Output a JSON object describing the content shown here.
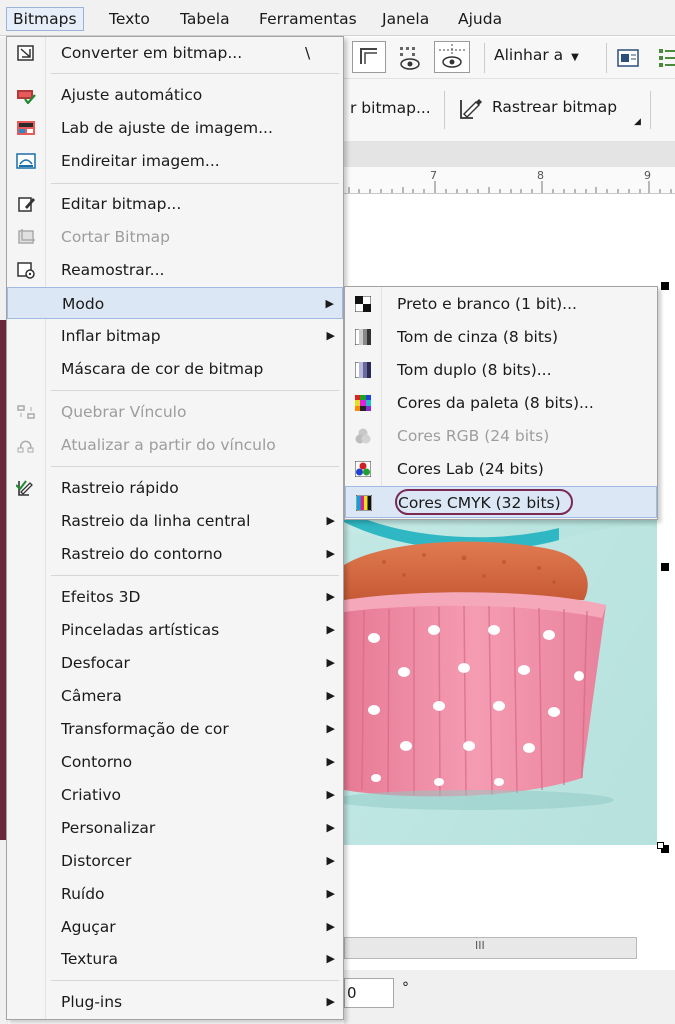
{
  "menubar": {
    "items": [
      "Bitmaps",
      "Texto",
      "Tabela",
      "Ferramentas",
      "Janela",
      "Ajuda"
    ]
  },
  "toolbar": {
    "align_label": "Alinhar a",
    "convert_partial": "r bitmap...",
    "trace_label": "Rastrear bitmap"
  },
  "ruler": {
    "ticks": [
      "7",
      "8",
      "9"
    ]
  },
  "bottom": {
    "field_value": "0",
    "degree": "°",
    "scroll_grip": "III"
  },
  "menu": {
    "items": [
      {
        "label": "Converter em bitmap...",
        "shortcut": "\\",
        "icon": "convert-bitmap-icon"
      },
      {
        "label": "Ajuste automático",
        "icon": "auto-adjust-icon"
      },
      {
        "label": "Lab de ajuste de imagem...",
        "icon": "image-adjust-lab-icon"
      },
      {
        "label": "Endireitar imagem...",
        "icon": "straighten-image-icon"
      },
      {
        "label": "Editar bitmap...",
        "icon": "edit-bitmap-icon"
      },
      {
        "label": "Cortar Bitmap",
        "icon": "crop-bitmap-icon"
      },
      {
        "label": "Reamostrar...",
        "icon": "resample-icon"
      },
      {
        "label": "Modo"
      },
      {
        "label": "Inflar bitmap"
      },
      {
        "label": "Máscara de cor de bitmap"
      },
      {
        "label": "Quebrar Vínculo",
        "icon": "break-link-icon"
      },
      {
        "label": "Atualizar a partir do vínculo",
        "icon": "update-link-icon"
      },
      {
        "label": "Rastreio rápido",
        "icon": "quick-trace-icon"
      },
      {
        "label": "Rastreio da linha central"
      },
      {
        "label": "Rastreio do contorno"
      },
      {
        "label": "Efeitos 3D"
      },
      {
        "label": "Pinceladas artísticas"
      },
      {
        "label": "Desfocar"
      },
      {
        "label": "Câmera"
      },
      {
        "label": "Transformação de cor"
      },
      {
        "label": "Contorno"
      },
      {
        "label": "Criativo"
      },
      {
        "label": "Personalizar"
      },
      {
        "label": "Distorcer"
      },
      {
        "label": "Ruído"
      },
      {
        "label": "Aguçar"
      },
      {
        "label": "Textura"
      },
      {
        "label": "Plug-ins"
      }
    ]
  },
  "submenu": {
    "items": [
      {
        "label": "Preto e branco (1 bit)...",
        "icon": "black-white-icon"
      },
      {
        "label": "Tom de cinza (8 bits)",
        "icon": "grayscale-icon"
      },
      {
        "label": "Tom duplo (8 bits)...",
        "icon": "duotone-icon"
      },
      {
        "label": "Cores da paleta (8 bits)...",
        "icon": "palette-colors-icon"
      },
      {
        "label": "Cores RGB (24 bits)",
        "icon": "rgb-colors-icon"
      },
      {
        "label": "Cores Lab (24 bits)",
        "icon": "lab-colors-icon"
      },
      {
        "label": "Cores CMYK (32 bits)",
        "icon": "cmyk-colors-icon"
      }
    ]
  },
  "colors": {
    "highlight": "#dce7f6",
    "oval": "#7a2952",
    "cupcake_liner": "#f08fa8",
    "frosting": "#4cc3c9"
  }
}
